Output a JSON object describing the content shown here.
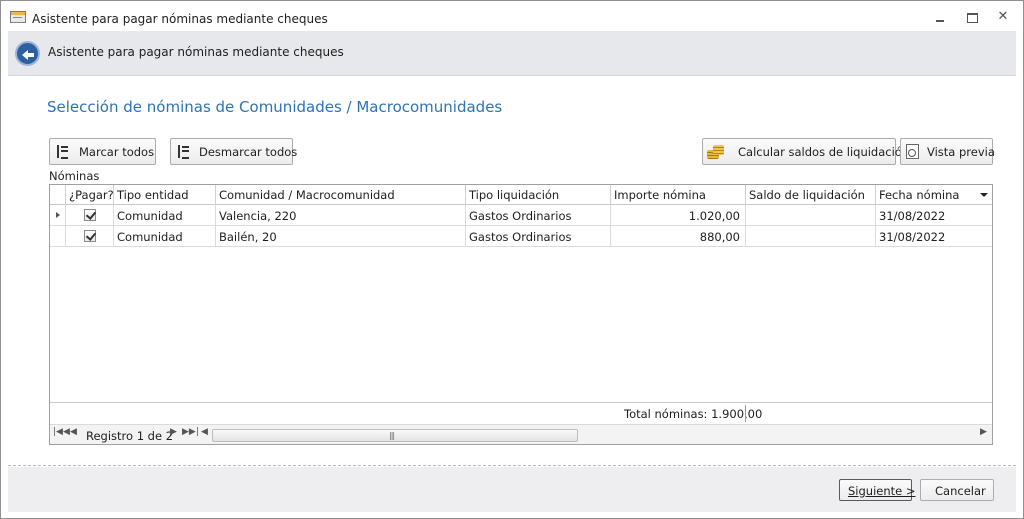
{
  "window": {
    "title": "Asistente para pagar nóminas mediante cheques",
    "controls": {
      "minimize": "",
      "maximize": "",
      "close": "✕"
    }
  },
  "header": {
    "title": "Asistente para pagar nóminas mediante cheques"
  },
  "main": {
    "section_title": "Selección de nóminas de Comunidades / Macrocomunidades",
    "toolbar": {
      "mark_all": "Marcar todos",
      "unmark_all": "Desmarcar todos",
      "calc_balances": "Calcular saldos de liquidación",
      "preview": "Vista previa"
    },
    "grid_label": "Nóminas",
    "grid": {
      "columns": [
        "¿Pagar?",
        "Tipo entidad",
        "Comunidad / Macrocomunidad",
        "Tipo liquidación",
        "Importe nómina",
        "Saldo de liquidación",
        "Fecha nómina"
      ],
      "rows": [
        {
          "pay": true,
          "tipo_entidad": "Comunidad",
          "comunidad": "Valencia, 220",
          "tipo_liquidacion": "Gastos Ordinarios",
          "importe": "1.020,00",
          "saldo": "",
          "fecha": "31/08/2022"
        },
        {
          "pay": true,
          "tipo_entidad": "Comunidad",
          "comunidad": "Bailén, 20",
          "tipo_liquidacion": "Gastos Ordinarios",
          "importe": "880,00",
          "saldo": "",
          "fecha": "31/08/2022"
        }
      ],
      "footer_total": "Total nóminas: 1.900,00",
      "record_text": "Registro 1 de 2"
    }
  },
  "footer": {
    "next": "Siguiente >",
    "cancel": "Cancelar"
  }
}
